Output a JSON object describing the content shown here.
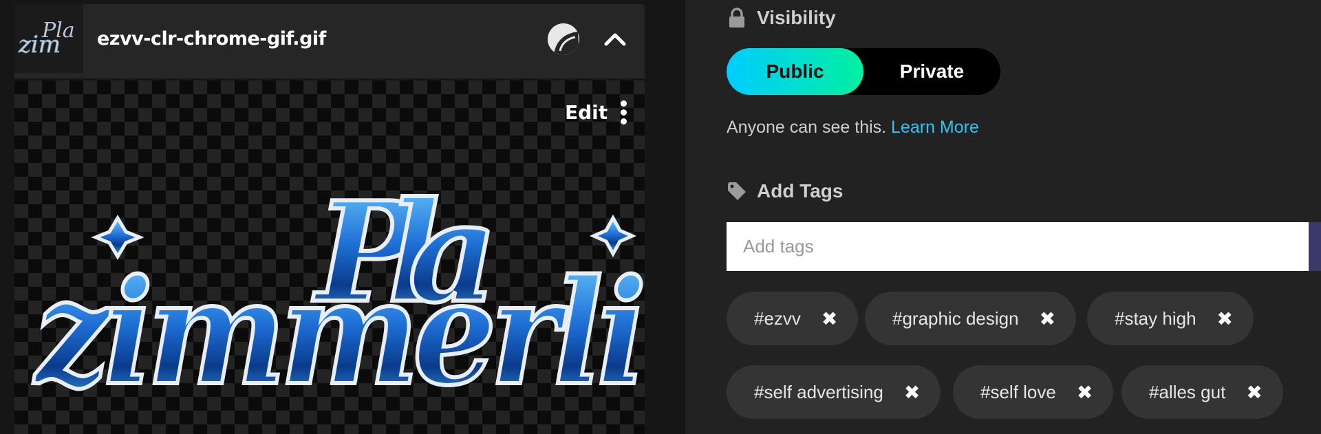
{
  "file": {
    "name": "ezvv-clr-chrome-gif.gif",
    "thumbnail_icon": "image-thumbnail",
    "pin_icon": "pin-icon",
    "collapse_icon": "chevron-up-icon"
  },
  "preview": {
    "edit_label": "Edit",
    "menu_icon": "more-vertical-icon",
    "artwork_lettering": "zimmerli"
  },
  "visibility": {
    "label": "Visibility",
    "icon": "lock-icon",
    "options": [
      "Public",
      "Private"
    ],
    "selected": "Public",
    "note": "Anyone can see this.",
    "learn_more": "Learn More"
  },
  "tags": {
    "label": "Add Tags",
    "icon": "tag-icon",
    "placeholder": "Add tags",
    "items": [
      "#ezvv",
      "#graphic design",
      "#stay high",
      "#self advertising",
      "#self love",
      "#alles gut"
    ],
    "remove_glyph": "✖"
  },
  "colors": {
    "accent_link": "#2ec4f0",
    "toggle_gradient_start": "#00ccff",
    "toggle_gradient_end": "#00f0a0"
  }
}
